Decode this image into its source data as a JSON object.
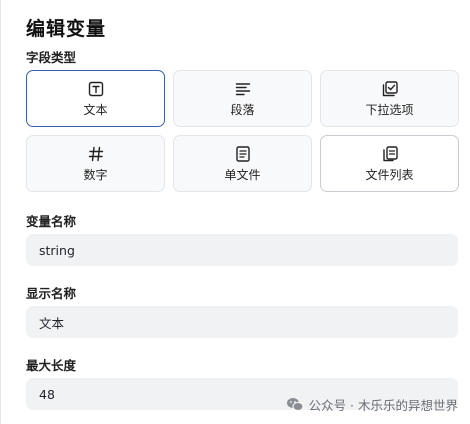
{
  "dialog": {
    "title": "编辑变量",
    "field_type_label": "字段类型",
    "field_types": [
      {
        "label": "文本",
        "icon": "text-type-icon",
        "selected": true
      },
      {
        "label": "段落",
        "icon": "paragraph-icon",
        "selected": false
      },
      {
        "label": "下拉选项",
        "icon": "select-checkbox-icon",
        "selected": false
      },
      {
        "label": "数字",
        "icon": "hash-icon",
        "selected": false
      },
      {
        "label": "单文件",
        "icon": "file-icon",
        "selected": false
      },
      {
        "label": "文件列表",
        "icon": "file-list-icon",
        "selected": false
      }
    ],
    "variable_name_label": "变量名称",
    "variable_name_value": "string",
    "display_name_label": "显示名称",
    "display_name_value": "文本",
    "max_length_label": "最大长度",
    "max_length_value": "48"
  },
  "watermark": {
    "text": "公众号 · 木乐乐的异想世界",
    "icon": "wechat-icon"
  },
  "colors": {
    "selected_border": "#3a5fa8",
    "card_bg": "#f8f9fa",
    "input_bg": "#f1f2f4"
  }
}
